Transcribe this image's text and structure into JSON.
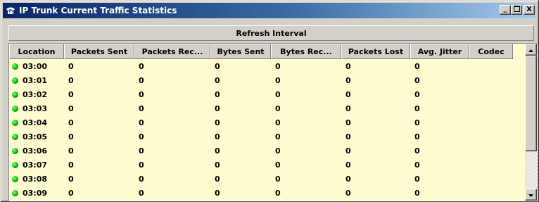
{
  "window": {
    "title": "IP Trunk Current Traffic Statistics",
    "icon": "phone-icon",
    "controls": {
      "minimize": "_",
      "maximize": "□",
      "close": "X"
    }
  },
  "refresh_interval_label": "Refresh Interval",
  "table": {
    "columns": [
      "Location",
      "Packets Sent",
      "Packets Rec...",
      "Bytes Sent",
      "Bytes Rec...",
      "Packets Lost",
      "Avg. Jitter",
      "Codec"
    ],
    "rows": [
      {
        "location": "03:00",
        "status": "online",
        "packets_sent": "0",
        "packets_rec": "0",
        "bytes_sent": "0",
        "bytes_rec": "0",
        "packets_lost": "0",
        "avg_jitter": "0",
        "codec": ""
      },
      {
        "location": "03:01",
        "status": "online",
        "packets_sent": "0",
        "packets_rec": "0",
        "bytes_sent": "0",
        "bytes_rec": "0",
        "packets_lost": "0",
        "avg_jitter": "0",
        "codec": ""
      },
      {
        "location": "03:02",
        "status": "online",
        "packets_sent": "0",
        "packets_rec": "0",
        "bytes_sent": "0",
        "bytes_rec": "0",
        "packets_lost": "0",
        "avg_jitter": "0",
        "codec": ""
      },
      {
        "location": "03:03",
        "status": "online",
        "packets_sent": "0",
        "packets_rec": "0",
        "bytes_sent": "0",
        "bytes_rec": "0",
        "packets_lost": "0",
        "avg_jitter": "0",
        "codec": ""
      },
      {
        "location": "03:04",
        "status": "online",
        "packets_sent": "0",
        "packets_rec": "0",
        "bytes_sent": "0",
        "bytes_rec": "0",
        "packets_lost": "0",
        "avg_jitter": "0",
        "codec": ""
      },
      {
        "location": "03:05",
        "status": "online",
        "packets_sent": "0",
        "packets_rec": "0",
        "bytes_sent": "0",
        "bytes_rec": "0",
        "packets_lost": "0",
        "avg_jitter": "0",
        "codec": ""
      },
      {
        "location": "03:06",
        "status": "online",
        "packets_sent": "0",
        "packets_rec": "0",
        "bytes_sent": "0",
        "bytes_rec": "0",
        "packets_lost": "0",
        "avg_jitter": "0",
        "codec": ""
      },
      {
        "location": "03:07",
        "status": "online",
        "packets_sent": "0",
        "packets_rec": "0",
        "bytes_sent": "0",
        "bytes_rec": "0",
        "packets_lost": "0",
        "avg_jitter": "0",
        "codec": ""
      },
      {
        "location": "03:08",
        "status": "online",
        "packets_sent": "0",
        "packets_rec": "0",
        "bytes_sent": "0",
        "bytes_rec": "0",
        "packets_lost": "0",
        "avg_jitter": "0",
        "codec": ""
      },
      {
        "location": "03:09",
        "status": "online",
        "packets_sent": "0",
        "packets_rec": "0",
        "bytes_sent": "0",
        "bytes_rec": "0",
        "packets_lost": "0",
        "avg_jitter": "0",
        "codec": ""
      }
    ]
  },
  "colors": {
    "title_gradient_start": "#0a246a",
    "title_gradient_end": "#a6caf0",
    "table_background": "#fffcd0",
    "status_online": "#00b000"
  },
  "scrollbar": {
    "up_icon": "arrow-up-icon",
    "down_icon": "arrow-down-icon"
  }
}
